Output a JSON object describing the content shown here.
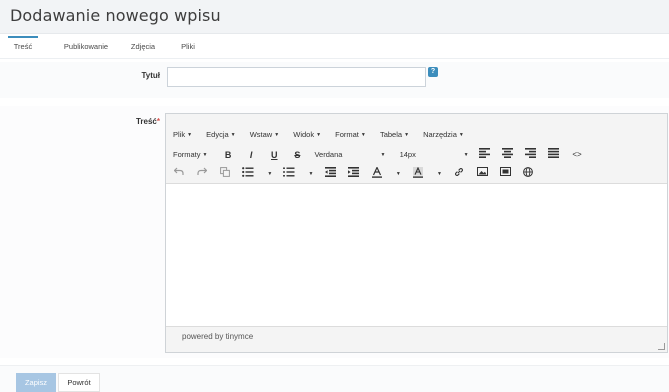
{
  "page": {
    "title": "Dodawanie nowego wpisu"
  },
  "tabs": [
    {
      "label": "Treść",
      "active": true
    },
    {
      "label": "Publikowanie",
      "active": false
    },
    {
      "label": "Zdjęcia",
      "active": false
    },
    {
      "label": "Pliki",
      "active": false
    }
  ],
  "form": {
    "title_label": "Tytuł",
    "title_value": "",
    "content_label": "Treść",
    "required_mark": "*",
    "help_icon_glyph": "?"
  },
  "editor": {
    "menubar": [
      "Plik",
      "Edycja",
      "Wstaw",
      "Widok",
      "Format",
      "Tabela",
      "Narzędzia"
    ],
    "caret": "▼",
    "formats_label": "Formaty",
    "bold": "B",
    "italic": "I",
    "underline": "U",
    "strike": "S",
    "font_family": "Verdana",
    "font_size": "14px",
    "code_glyph": "<>",
    "content": "",
    "statusbar_text": "powered by tinymce"
  },
  "buttons": {
    "save": "Zapisz",
    "back": "Powrót"
  },
  "colors": {
    "accent": "#3c8dbc",
    "primary_button": "#a7c6e3",
    "required": "#d9534f"
  }
}
